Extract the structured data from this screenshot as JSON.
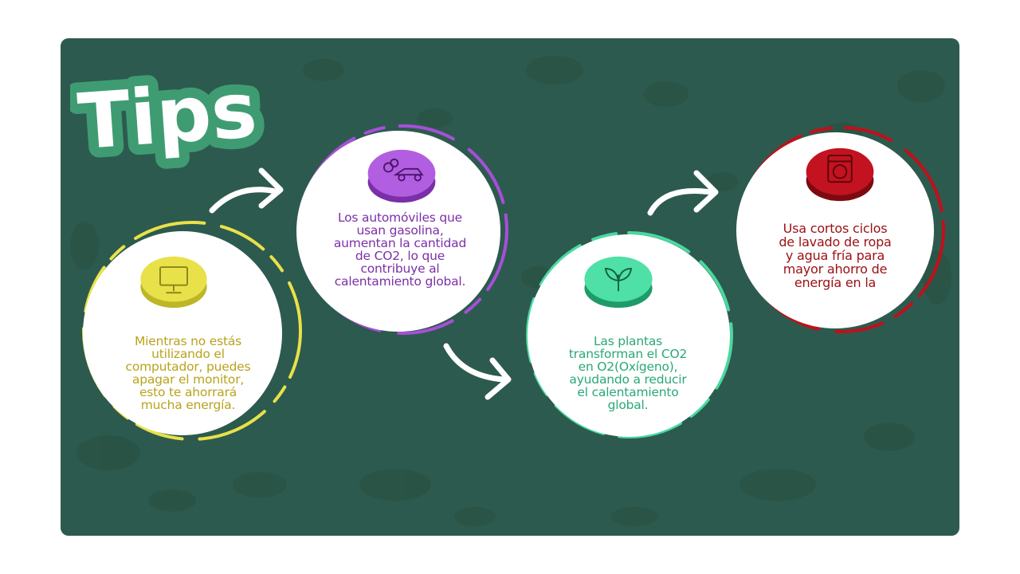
{
  "title": "Tips",
  "colors": {
    "background": "#2d5a4e",
    "title_fill": "#ffffff",
    "title_outline": "#3f9c72",
    "yellow": "#e9e14a",
    "yellow_text": "#b8a31d",
    "purple": "#a64fd8",
    "purple_text": "#7b2fa8",
    "green": "#49d89f",
    "green_text": "#2aa877",
    "red": "#c0101a",
    "red_text": "#9a1014"
  },
  "tips": [
    {
      "icon": "monitor-icon",
      "lines": [
        "Mientras no estás",
        "utilizando el",
        "computador, puedes",
        "apagar el monitor,",
        "esto te ahorrará",
        "mucha energía."
      ]
    },
    {
      "icon": "car-exhaust-icon",
      "lines": [
        "Los automóviles que",
        "usan gasolina,",
        "aumentan la cantidad",
        "de CO2, lo que",
        "contribuye al",
        "calentamiento global."
      ]
    },
    {
      "icon": "plant-icon",
      "lines": [
        "Las plantas",
        "transforman el CO2",
        "en O2(Oxígeno),",
        "ayudando a reducir",
        "el calentamiento",
        "global."
      ]
    },
    {
      "icon": "washing-machine-icon",
      "lines": [
        "Usa cortos ciclos",
        "de lavado de ropa",
        "y agua fría para",
        "mayor ahorro de",
        "energía en la"
      ]
    }
  ]
}
